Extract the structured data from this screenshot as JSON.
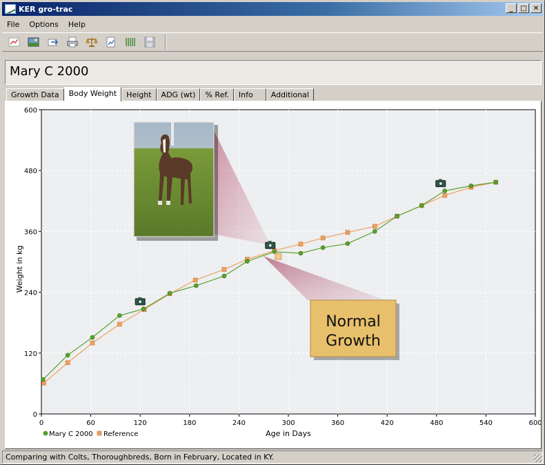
{
  "window": {
    "title": "KER gro-trac"
  },
  "window_buttons": {
    "minimize": "_",
    "maximize": "□",
    "close": "✕"
  },
  "menu": [
    {
      "label": "File"
    },
    {
      "label": "Options"
    },
    {
      "label": "Help"
    }
  ],
  "toolbar_icons": [
    "new-chart-icon",
    "photo-icon",
    "export-icon",
    "print-icon",
    "scale-icon",
    "report-icon",
    "data-grid-icon",
    "save-icon"
  ],
  "horse_name": "Mary C 2000",
  "tabs": [
    {
      "label": "Growth Data",
      "active": false
    },
    {
      "label": "Body Weight",
      "active": true
    },
    {
      "label": "Height",
      "active": false
    },
    {
      "label": "ADG (wt)",
      "active": false
    },
    {
      "label": "% Ref.",
      "active": false
    },
    {
      "label": "Info",
      "active": false
    },
    {
      "label": "Additional",
      "active": false
    }
  ],
  "callout": {
    "line1": "Normal",
    "line2": "Growth"
  },
  "status": "Comparing with  Colts,  Thoroughbreds,  Born in February,  Located in KY.",
  "colors": {
    "series_horse": "#5aa02c",
    "series_reference": "#f0a060",
    "callout_bg": "#e8c06c",
    "plot_bg": "#f0f1f3"
  },
  "chart_data": {
    "type": "line",
    "xlabel": "Age in Days",
    "ylabel": "Weight in kg",
    "xlim": [
      0,
      600
    ],
    "ylim": [
      0,
      600
    ],
    "xticks": [
      0,
      60,
      120,
      180,
      240,
      300,
      360,
      420,
      480,
      540,
      600
    ],
    "yticks": [
      0,
      120,
      240,
      360,
      480,
      600
    ],
    "grid": true,
    "legend": "bottom-left",
    "series": [
      {
        "name": "Mary C 2000",
        "marker": "circle",
        "x": [
          2,
          32,
          62,
          95,
          124,
          156,
          188,
          222,
          250,
          283,
          315,
          342,
          372,
          405,
          432,
          462,
          490,
          522,
          552
        ],
        "y": [
          68,
          116,
          151,
          194,
          207,
          238,
          253,
          272,
          301,
          320,
          317,
          328,
          336,
          360,
          390,
          411,
          440,
          450,
          457
        ]
      },
      {
        "name": "Reference",
        "marker": "square",
        "x": [
          3,
          32,
          62,
          95,
          125,
          156,
          187,
          222,
          250,
          283,
          315,
          342,
          372,
          405,
          432,
          462,
          490,
          522,
          552
        ],
        "y": [
          61,
          101,
          140,
          177,
          206,
          237,
          264,
          285,
          305,
          322,
          335,
          347,
          358,
          370,
          390,
          411,
          431,
          447,
          457
        ]
      }
    ],
    "photo_markers": [
      {
        "x": 120,
        "y": 222
      },
      {
        "x": 278,
        "y": 333
      },
      {
        "x": 485,
        "y": 455
      }
    ]
  }
}
